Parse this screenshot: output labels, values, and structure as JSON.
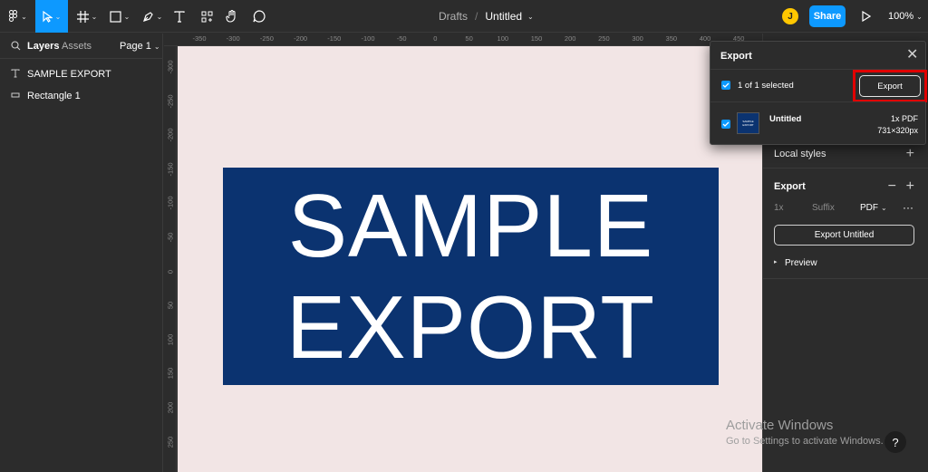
{
  "toolbar": {
    "icons": [
      "figma-menu-icon",
      "move-tool-icon",
      "frame-tool-icon",
      "shape-tool-icon",
      "pen-tool-icon",
      "text-tool-icon",
      "resources-icon",
      "hand-tool-icon",
      "comment-icon"
    ],
    "breadcrumb_drafts": "Drafts",
    "breadcrumb_sep": "/",
    "file_title": "Untitled",
    "avatar_initial": "J",
    "share_label": "Share",
    "zoom": "100%"
  },
  "left_panel": {
    "tab_layers": "Layers",
    "tab_assets": "Assets",
    "page": "Page 1",
    "layers": [
      {
        "name": "SAMPLE EXPORT",
        "icon": "text-layer-icon"
      },
      {
        "name": "Rectangle 1",
        "icon": "rectangle-layer-icon"
      }
    ]
  },
  "rulers": {
    "top": [
      "-350",
      "-300",
      "-250",
      "-200",
      "-150",
      "-100",
      "-50",
      "0",
      "50",
      "100",
      "150",
      "200",
      "250",
      "300",
      "350",
      "400",
      "450"
    ],
    "left": [
      "-300",
      "-250",
      "-200",
      "-150",
      "-100",
      "-50",
      "0",
      "50",
      "100",
      "150",
      "200",
      "250"
    ]
  },
  "canvas": {
    "background": "#f2e5e5",
    "frame_color": "#0b3370",
    "line1": "SAMPLE",
    "line2": "EXPORT"
  },
  "export_dialog": {
    "title": "Export",
    "selection": "1 of 1 selected",
    "export_button": "Export",
    "item_name": "Untitled",
    "item_format": "1x PDF",
    "item_size": "731×320px",
    "thumb_line1": "SAMPLE",
    "thumb_line2": "EXPORT"
  },
  "right_panel": {
    "local_styles": "Local styles",
    "export_section": "Export",
    "scale": "1x",
    "suffix_placeholder": "Suffix",
    "format": "PDF",
    "more": "···",
    "export_untitled": "Export Untitled",
    "preview": "Preview"
  },
  "watermark": {
    "title": "Activate Windows",
    "subtitle": "Go to Settings to activate Windows."
  },
  "help_label": "?",
  "colors": {
    "accent": "#0d99ff",
    "highlight": "#e00000"
  }
}
